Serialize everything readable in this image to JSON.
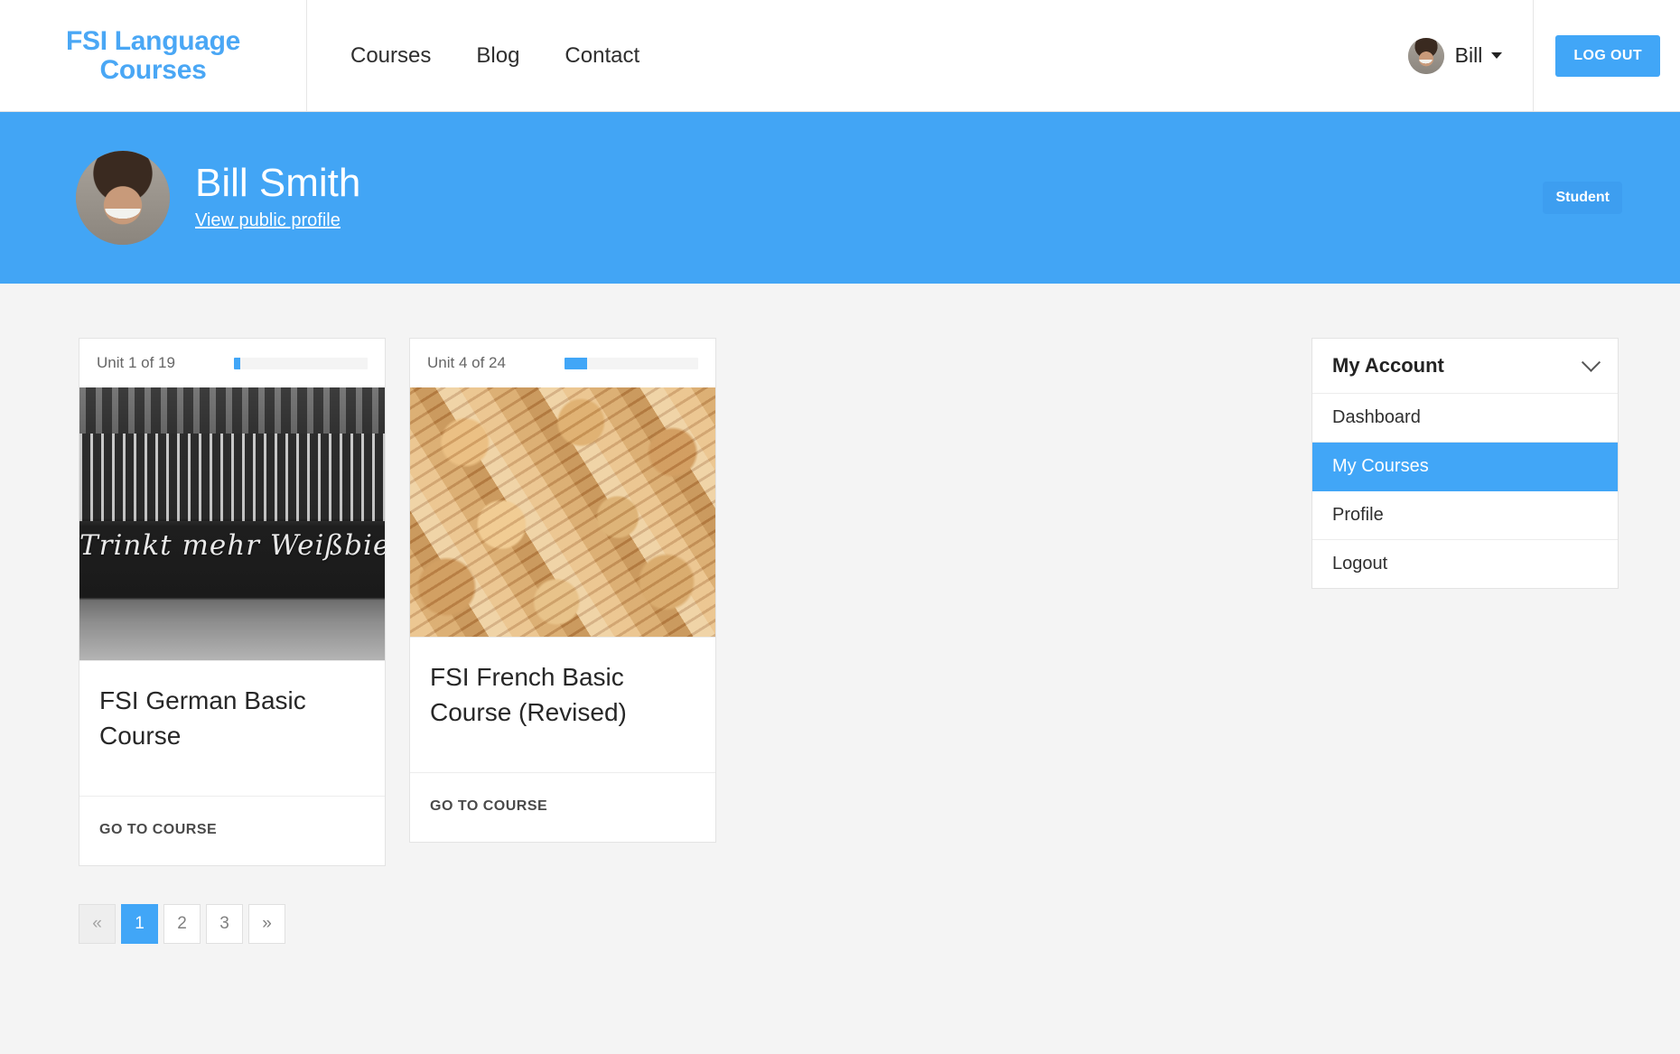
{
  "header": {
    "brand_line1": "FSI Language",
    "brand_line2": "Courses",
    "nav": [
      {
        "label": "Courses"
      },
      {
        "label": "Blog"
      },
      {
        "label": "Contact"
      }
    ],
    "user_name": "Bill",
    "logout_label": "LOG OUT",
    "accent_color": "#41a6f7"
  },
  "profile_banner": {
    "name": "Bill Smith",
    "public_profile_link": "View public profile",
    "role_badge": "Student",
    "background_color": "#42a5f5"
  },
  "courses": [
    {
      "unit_label": "Unit 1 of 19",
      "progress_percent": 5,
      "title": "FSI German Basic Course",
      "action_label": "GO TO COURSE",
      "image_caption": "Trinkt mehr Weißbier",
      "image_kind": "bw-beergarden-sign"
    },
    {
      "unit_label": "Unit 4 of 24",
      "progress_percent": 17,
      "title": "FSI French Basic Course (Revised)",
      "action_label": "GO TO COURSE",
      "image_caption": "",
      "image_kind": "wine-corks"
    }
  ],
  "pagination": [
    {
      "label": "«",
      "state": "disabled"
    },
    {
      "label": "1",
      "state": "active"
    },
    {
      "label": "2",
      "state": "normal"
    },
    {
      "label": "3",
      "state": "normal"
    },
    {
      "label": "»",
      "state": "normal"
    }
  ],
  "sidebar": {
    "panel_title": "My Account",
    "items": [
      {
        "label": "Dashboard",
        "active": false
      },
      {
        "label": "My Courses",
        "active": true
      },
      {
        "label": "Profile",
        "active": false
      },
      {
        "label": "Logout",
        "active": false
      }
    ]
  }
}
